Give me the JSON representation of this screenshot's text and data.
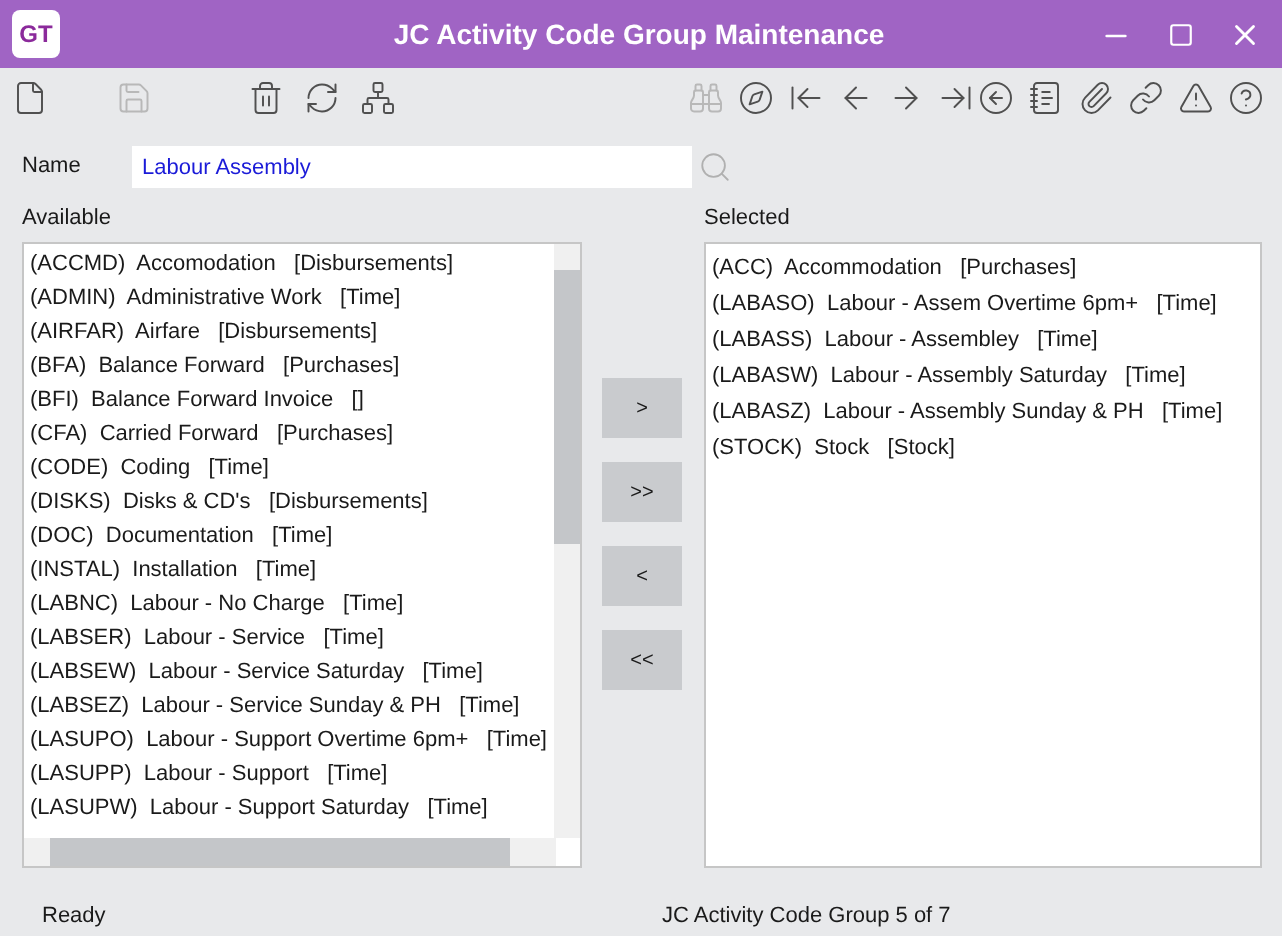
{
  "window": {
    "logo": "GT",
    "title": "JC Activity Code Group Maintenance"
  },
  "toolbar": [
    {
      "kind": "new",
      "disabled": false
    },
    {
      "kind": "save",
      "disabled": true
    },
    {
      "kind": "delete",
      "disabled": false
    },
    {
      "kind": "refresh",
      "disabled": false
    },
    {
      "kind": "network",
      "disabled": false
    },
    {
      "kind": "find",
      "disabled": true
    },
    {
      "kind": "compass",
      "disabled": false
    },
    {
      "kind": "first",
      "disabled": false
    },
    {
      "kind": "prev",
      "disabled": false
    },
    {
      "kind": "next",
      "disabled": false
    },
    {
      "kind": "last",
      "disabled": false
    },
    {
      "kind": "back",
      "disabled": false
    },
    {
      "kind": "notes",
      "disabled": false
    },
    {
      "kind": "attach",
      "disabled": false
    },
    {
      "kind": "link",
      "disabled": false
    },
    {
      "kind": "alert",
      "disabled": false
    },
    {
      "kind": "help",
      "disabled": false
    }
  ],
  "name_field": {
    "label": "Name",
    "value": "Labour Assembly"
  },
  "available": {
    "label": "Available",
    "items": [
      "(ACCMD)  Accomodation   [Disbursements]",
      "(ADMIN)  Administrative Work   [Time]",
      "(AIRFAR)  Airfare   [Disbursements]",
      "(BFA)  Balance Forward   [Purchases]",
      "(BFI)  Balance Forward Invoice   []",
      "(CFA)  Carried Forward   [Purchases]",
      "(CODE)  Coding   [Time]",
      "(DISKS)  Disks & CD's   [Disbursements]",
      "(DOC)  Documentation   [Time]",
      "(INSTAL)  Installation   [Time]",
      "(LABNC)  Labour - No Charge   [Time]",
      "(LABSER)  Labour - Service   [Time]",
      "(LABSEW)  Labour - Service Saturday   [Time]",
      "(LABSEZ)  Labour - Service Sunday & PH   [Time]",
      "(LASUPO)  Labour - Support Overtime 6pm+   [Time]",
      "(LASUPP)  Labour - Support   [Time]",
      "(LASUPW)  Labour - Support Saturday   [Time]"
    ]
  },
  "transfer_buttons": [
    ">",
    ">>",
    "<",
    "<<"
  ],
  "selected": {
    "label": "Selected",
    "items": [
      "(ACC)  Accommodation   [Purchases]",
      "(LABASO)  Labour - Assem Overtime 6pm+   [Time]",
      "(LABASS)  Labour - Assembley   [Time]",
      "(LABASW)  Labour - Assembly Saturday   [Time]",
      "(LABASZ)  Labour - Assembly Sunday & PH   [Time]",
      "(STOCK)  Stock   [Stock]"
    ]
  },
  "status_bar": {
    "status": "Ready",
    "record": "JC Activity Code Group 5 of 7"
  }
}
